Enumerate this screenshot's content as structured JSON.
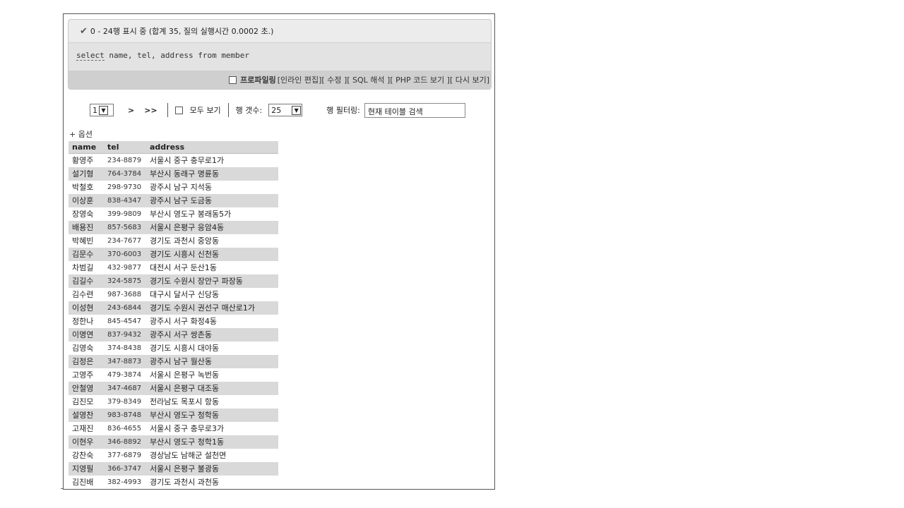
{
  "result": {
    "message": "0 - 24행 표시 중 (합계 35, 질의 실행시간 0.0002 초.)",
    "query_keyword": "select",
    "query_rest": " name, tel, address from member"
  },
  "links": {
    "profiling": "프로파일링",
    "items": [
      "[인라인 편집]",
      "[ 수정 ]",
      "[ SQL 해석 ]",
      "[ PHP 코드 보기 ]",
      "[ 다시 보기]"
    ]
  },
  "nav": {
    "page": "1",
    "next": ">",
    "last": ">>",
    "show_all": "모두 보기",
    "rows_label": "행 갯수:",
    "rows_value": "25",
    "filter_label": "행 필터링:",
    "filter_placeholder": "현재 테이블 검색"
  },
  "options_link": "+ 옵션",
  "table": {
    "columns": [
      "name",
      "tel",
      "address"
    ],
    "rows": [
      [
        "황영주",
        "234-8879",
        "서울시 중구 충무로1가"
      ],
      [
        "설기형",
        "764-3784",
        "부산시 동래구 명륜동"
      ],
      [
        "박철호",
        "298-9730",
        "광주시 남구 지석동"
      ],
      [
        "이상훈",
        "838-4347",
        "광주시 남구 도금동"
      ],
      [
        "장영숙",
        "399-9809",
        "부산시 영도구 봉래동5가"
      ],
      [
        "배용진",
        "857-5683",
        "서울시 은평구 응암4동"
      ],
      [
        "박혜빈",
        "234-7677",
        "경기도 과천시 중앙동"
      ],
      [
        "김문수",
        "370-6003",
        "경기도 시흥시 신천동"
      ],
      [
        "차범길",
        "432-9877",
        "대전시 서구 둔산1동"
      ],
      [
        "김길수",
        "324-5875",
        "경기도 수원시 장안구 파장동"
      ],
      [
        "김수련",
        "987-3688",
        "대구시 달서구 신당동"
      ],
      [
        "이성현",
        "243-6844",
        "경기도 수원시 권선구 매산로1가"
      ],
      [
        "정한나",
        "845-4547",
        "광주시 서구 화정4동"
      ],
      [
        "이명연",
        "837-9432",
        "광주시 서구 쌍촌동"
      ],
      [
        "김영숙",
        "374-8438",
        "경기도 시흥시 대야동"
      ],
      [
        "김정은",
        "347-8873",
        "광주시 남구 월산동"
      ],
      [
        "고영주",
        "479-3874",
        "서울시 은평구 녹번동"
      ],
      [
        "안철영",
        "347-4687",
        "서울시 은평구 대조동"
      ],
      [
        "김진모",
        "379-8349",
        "전라남도 목포시 항동"
      ],
      [
        "설영찬",
        "983-8748",
        "부산시 영도구 청학동"
      ],
      [
        "고재진",
        "836-4655",
        "서울시 중구 충무로3가"
      ],
      [
        "이현우",
        "346-8892",
        "부산시 영도구 청학1동"
      ],
      [
        "강찬숙",
        "377-6879",
        "경상남도 남해군 설천면"
      ],
      [
        "지영필",
        "366-3747",
        "서울시 은평구 불광동"
      ],
      [
        "김진배",
        "382-4993",
        "경기도 과천시 과천동"
      ]
    ]
  }
}
